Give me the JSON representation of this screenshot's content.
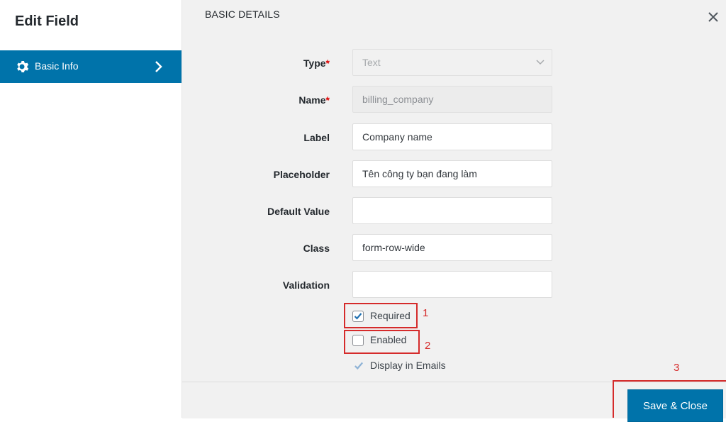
{
  "sidebar": {
    "title": "Edit Field",
    "items": [
      {
        "label": "Basic Info",
        "icon": "gear-icon"
      }
    ]
  },
  "main": {
    "section_title": "BASIC DETAILS",
    "fields": {
      "type": {
        "label": "Type",
        "value": "Text"
      },
      "name": {
        "label": "Name",
        "value": "billing_company"
      },
      "label": {
        "label": "Label",
        "value": "Company name"
      },
      "placeholder": {
        "label": "Placeholder",
        "value": "Tên công ty bạn đang làm"
      },
      "default_value": {
        "label": "Default Value",
        "value": ""
      },
      "class": {
        "label": "Class",
        "value": "form-row-wide"
      },
      "validation": {
        "label": "Validation",
        "value": ""
      }
    },
    "required_mark": "*",
    "checkboxes": {
      "required": {
        "label": "Required",
        "checked": true
      },
      "enabled": {
        "label": "Enabled",
        "checked": false
      },
      "display_in_emails": {
        "label": "Display in Emails",
        "checked": true
      }
    },
    "annotations": [
      "1",
      "2",
      "3"
    ]
  },
  "footer": {
    "save_label": "Save & Close"
  },
  "colors": {
    "accent": "#0073aa",
    "annotation": "#d52b2b"
  }
}
